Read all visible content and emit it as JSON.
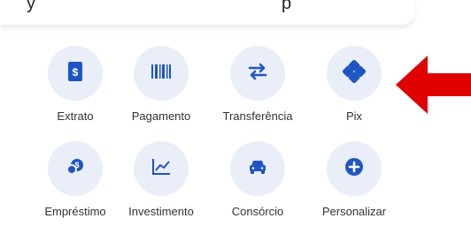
{
  "header": {
    "left_text": "y",
    "right_text": "p"
  },
  "colors": {
    "accent": "#1f55c3",
    "circle_bg": "#e9eef8",
    "arrow": "#e00000"
  },
  "shortcuts": [
    {
      "label": "Extrato",
      "icon": "statement-icon"
    },
    {
      "label": "Pagamento",
      "icon": "barcode-icon"
    },
    {
      "label": "Transferência",
      "icon": "transfer-arrows-icon"
    },
    {
      "label": "Pix",
      "icon": "pix-icon"
    },
    {
      "label": "Empréstimo",
      "icon": "loan-icon"
    },
    {
      "label": "Investimento",
      "icon": "chart-icon"
    },
    {
      "label": "Consórcio",
      "icon": "car-icon"
    },
    {
      "label": "Personalizar",
      "icon": "plus-circle-icon"
    }
  ]
}
